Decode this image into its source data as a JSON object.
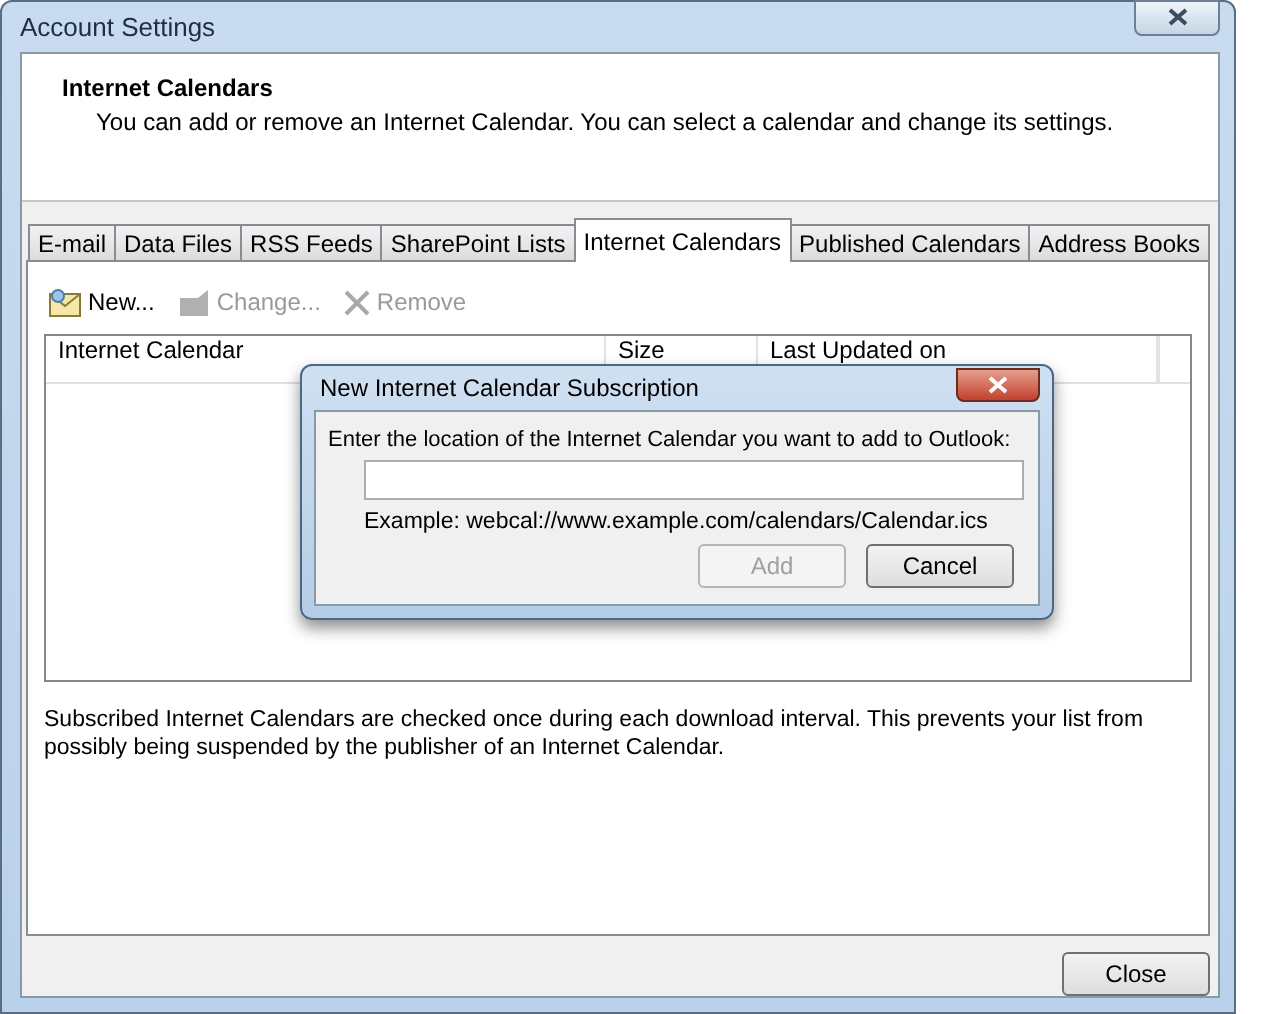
{
  "window": {
    "title": "Account Settings"
  },
  "header": {
    "title": "Internet Calendars",
    "description": "You can add or remove an Internet Calendar. You can select a calendar and change its settings."
  },
  "tabs": [
    {
      "label": "E-mail",
      "selected": false
    },
    {
      "label": "Data Files",
      "selected": false
    },
    {
      "label": "RSS Feeds",
      "selected": false
    },
    {
      "label": "SharePoint Lists",
      "selected": false
    },
    {
      "label": "Internet Calendars",
      "selected": true
    },
    {
      "label": "Published Calendars",
      "selected": false
    },
    {
      "label": "Address Books",
      "selected": false
    }
  ],
  "toolbar": [
    {
      "kind": "new",
      "label": "New...",
      "disabled": false
    },
    {
      "kind": "change",
      "label": "Change...",
      "disabled": true
    },
    {
      "kind": "remove",
      "label": "Remove",
      "disabled": true
    }
  ],
  "table": {
    "columns": [
      "Internet Calendar",
      "Size",
      "Last Updated on"
    ]
  },
  "note": "Subscribed Internet Calendars are checked once during each download interval. This prevents your list from possibly being suspended by the publisher of an Internet Calendar.",
  "footer_buttons": [
    {
      "label": "Close",
      "disabled": false
    }
  ],
  "dialog": {
    "title": "New Internet Calendar Subscription",
    "prompt": "Enter the location of the Internet Calendar you want to add to Outlook:",
    "example": "Example: webcal://www.example.com/calendars/Calendar.ics",
    "buttons": [
      {
        "label": "Add",
        "disabled": true
      },
      {
        "label": "Cancel",
        "disabled": false
      }
    ]
  }
}
